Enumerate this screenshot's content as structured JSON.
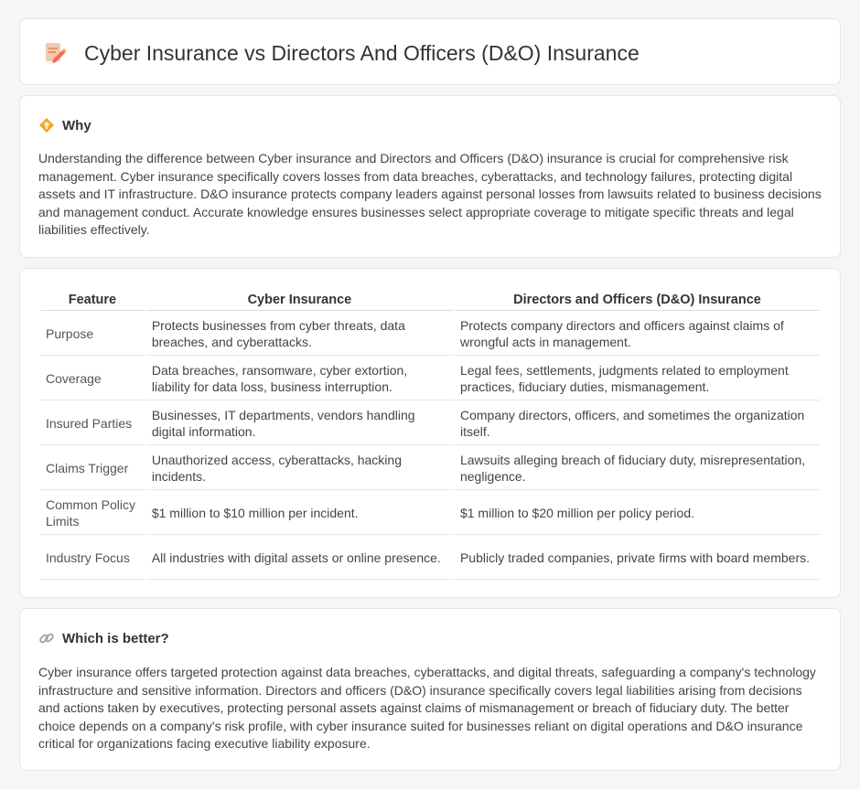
{
  "page": {
    "title": "Cyber Insurance vs Directors And Officers (D&O) Insurance",
    "title_icon": "document-edit-icon"
  },
  "why": {
    "heading": "Why",
    "icon": "lightbulb-icon",
    "text": "Understanding the difference between Cyber insurance and Directors and Officers (D&O) insurance is crucial for comprehensive risk management. Cyber insurance specifically covers losses from data breaches, cyberattacks, and technology failures, protecting digital assets and IT infrastructure. D&O insurance protects company leaders against personal losses from lawsuits related to business decisions and management conduct. Accurate knowledge ensures businesses select appropriate coverage to mitigate specific threats and legal liabilities effectively."
  },
  "comparison": {
    "headers": [
      "Feature",
      "Cyber Insurance",
      "Directors and Officers (D&O) Insurance"
    ],
    "rows": [
      [
        "Purpose",
        "Protects businesses from cyber threats, data breaches, and cyberattacks.",
        "Protects company directors and officers against claims of wrongful acts in management."
      ],
      [
        "Coverage",
        "Data breaches, ransomware, cyber extortion, liability for data loss, business interruption.",
        "Legal fees, settlements, judgments related to employment practices, fiduciary duties, mismanagement."
      ],
      [
        "Insured Parties",
        "Businesses, IT departments, vendors handling digital information.",
        "Company directors, officers, and sometimes the organization itself."
      ],
      [
        "Claims Trigger",
        "Unauthorized access, cyberattacks, hacking incidents.",
        "Lawsuits alleging breach of fiduciary duty, misrepresentation, negligence."
      ],
      [
        "Common Policy Limits",
        "$1 million to $10 million per incident.",
        "$1 million to $20 million per policy period."
      ],
      [
        "Industry Focus",
        "All industries with digital assets or online presence.",
        "Publicly traded companies, private firms with board members."
      ]
    ]
  },
  "which": {
    "heading": "Which is better?",
    "icon": "link-icon",
    "text": "Cyber insurance offers targeted protection against data breaches, cyberattacks, and digital threats, safeguarding a company's technology infrastructure and sensitive information. Directors and officers (D&O) insurance specifically covers legal liabilities arising from decisions and actions taken by executives, protecting personal assets against claims of mismanagement or breach of fiduciary duty. The better choice depends on a company's risk profile, with cyber insurance suited for businesses reliant on digital operations and D&O insurance critical for organizations facing executive liability exposure."
  },
  "colors": {
    "background": "#f5f6f8",
    "card": "#ffffff",
    "icon_accent": "#f08a4b",
    "lightbulb": "#f5a623"
  }
}
